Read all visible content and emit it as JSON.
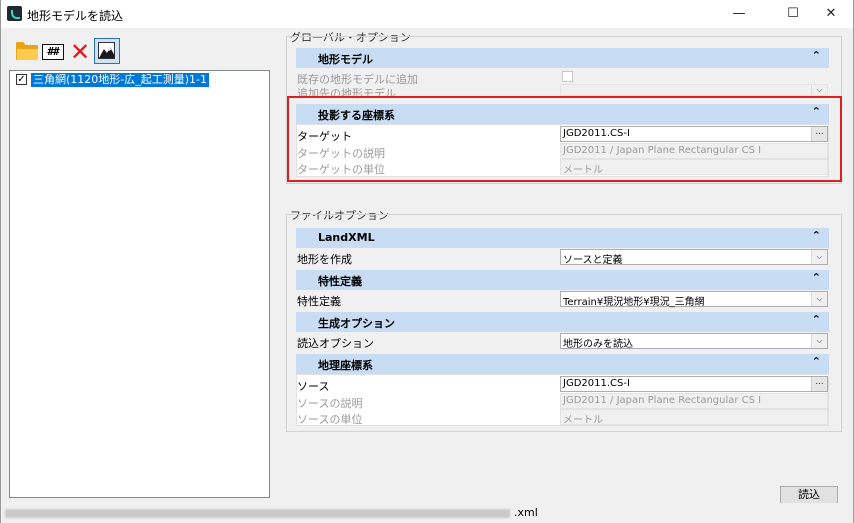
{
  "window": {
    "title": "地形モデルを読込",
    "minimize": "—",
    "maximize": "☐",
    "close": "✕"
  },
  "toolbar": {
    "grid_text": "##"
  },
  "tree": {
    "item_label": "三角網(1120地形-広_起工測量)1-1",
    "checked": "✓"
  },
  "global_options": {
    "label": "グローバル・オプション",
    "terrain_model": {
      "header": "地形モデル",
      "add_to_existing_label": "既存の地形モデルに追加",
      "add_target_label": "追加先の地形モデル"
    },
    "projection": {
      "header": "投影する座標系",
      "target_label": "ターゲット",
      "target_value": "JGD2011.CS-I",
      "target_desc_label": "ターゲットの説明",
      "target_desc_value": "JGD2011 / Japan Plane Rectangular CS I",
      "target_unit_label": "ターゲットの単位",
      "target_unit_value": "メートル"
    }
  },
  "file_options": {
    "label": "ファイルオプション",
    "landxml": {
      "header": "LandXML",
      "create_label": "地形を作成",
      "create_value": "ソースと定義"
    },
    "feature": {
      "header": "特性定義",
      "label": "特性定義",
      "value": "Terrain¥現況地形¥現況_三角網"
    },
    "generation": {
      "header": "生成オプション",
      "label": "読込オプション",
      "value": "地形のみを読込"
    },
    "geo_coord": {
      "header": "地理座標系",
      "source_label": "ソース",
      "source_value": "JGD2011.CS-I",
      "source_desc_label": "ソースの説明",
      "source_desc_value": "JGD2011 / Japan Plane Rectangular CS I",
      "source_unit_label": "ソースの単位",
      "source_unit_value": "メートル"
    }
  },
  "chevron_up": "⌃",
  "dropdown_arrow": "⌵",
  "ellipsis": "...",
  "status": {
    "path_suffix": ".xml"
  },
  "buttons": {
    "load": "読込"
  },
  "colors": {
    "section_header": "#c8dcf4",
    "selection": "#0078d7",
    "highlight_box": "#e02020"
  }
}
